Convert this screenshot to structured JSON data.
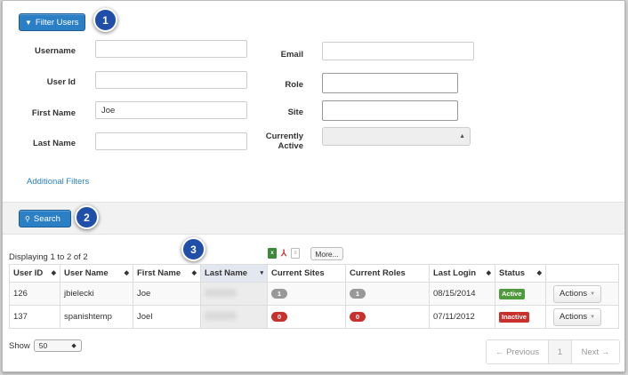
{
  "filter_button": {
    "label": "Filter Users",
    "icon": "funnel-icon"
  },
  "callouts": [
    "1",
    "2",
    "3"
  ],
  "filters": {
    "username": {
      "label": "Username",
      "value": ""
    },
    "user_id": {
      "label": "User Id",
      "value": ""
    },
    "first_name": {
      "label": "First Name",
      "value": "Joe"
    },
    "last_name": {
      "label": "Last Name",
      "value": ""
    },
    "email": {
      "label": "Email",
      "value": ""
    },
    "role": {
      "label": "Role",
      "value": ""
    },
    "site": {
      "label": "Site",
      "value": ""
    },
    "currently_active": {
      "label_line1": "Currently",
      "label_line2": "Active",
      "value": ""
    }
  },
  "additional_filters": "Additional Filters",
  "search_button": {
    "label": "Search",
    "icon": "search-icon"
  },
  "displaying": "Displaying 1 to 2 of 2",
  "export": {
    "more_label": "More..."
  },
  "table": {
    "headers": [
      "User ID",
      "User Name",
      "First Name",
      "Last Name",
      "Current Sites",
      "Current Roles",
      "Last Login",
      "Status",
      ""
    ],
    "sorted_column": "Last Name",
    "rows": [
      {
        "user_id": "126",
        "user_name": "jbielecki",
        "first_name": "Joe",
        "last_name": "",
        "sites": "1",
        "roles": "1",
        "last_login": "08/15/2014",
        "status": "Active",
        "action": "Actions"
      },
      {
        "user_id": "137",
        "user_name": "spanishtemp",
        "first_name": "Joel",
        "last_name": "",
        "sites": "0",
        "roles": "0",
        "last_login": "07/11/2012",
        "status": "Inactive",
        "action": "Actions"
      }
    ]
  },
  "show": {
    "label": "Show",
    "value": "50"
  },
  "pagination": {
    "previous": "← Previous",
    "page": "1",
    "next": "Next →"
  },
  "colors": {
    "primary": "#2a7fc5",
    "callout": "#1f4fa8",
    "active": "#4e9a3c",
    "inactive": "#c9302c"
  }
}
